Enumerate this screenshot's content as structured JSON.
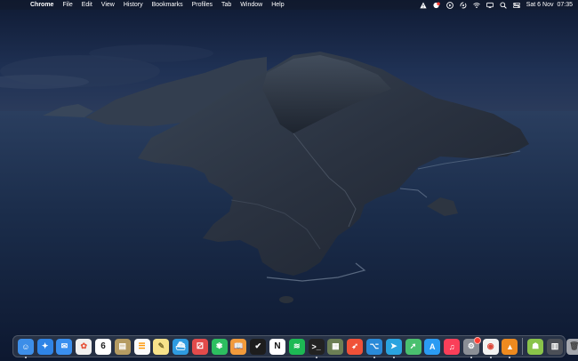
{
  "menubar": {
    "apple_glyph": "",
    "app_name": "Chrome",
    "menus": [
      "File",
      "Edit",
      "View",
      "History",
      "Bookmarks",
      "Profiles",
      "Tab",
      "Window",
      "Help"
    ],
    "status_icons": [
      "warning-triangle-icon",
      "notification-badge-icon",
      "play-circle-icon",
      "sync-icon",
      "wifi-icon",
      "screen-mirror-icon",
      "search-icon",
      "control-center-icon"
    ],
    "date": "Sat 6 Nov",
    "time": "07:35"
  },
  "dock": {
    "apps": [
      {
        "name": "finder-icon",
        "color": "#3d8ee8"
      },
      {
        "name": "safari-icon",
        "color": "#2f84e6"
      },
      {
        "name": "mail-icon",
        "color": "#3a8fef"
      },
      {
        "name": "photos-icon",
        "color": "#f0f0f0"
      },
      {
        "name": "calendar-icon",
        "color": "#ffffff",
        "text": "6"
      },
      {
        "name": "folder-app-icon",
        "color": "#b59b62"
      },
      {
        "name": "reminders-icon",
        "color": "#fafafa"
      },
      {
        "name": "notes-icon",
        "color": "#f7e28a"
      },
      {
        "name": "docker-icon",
        "color": "#2f9be0"
      },
      {
        "name": "dice-game-icon",
        "color": "#e24b4b"
      },
      {
        "name": "evernote-icon",
        "color": "#2dbe60"
      },
      {
        "name": "books-icon",
        "color": "#f19a3b"
      },
      {
        "name": "todo-app-icon",
        "color": "#1d1d1d"
      },
      {
        "name": "notion-icon",
        "color": "#ffffff",
        "text": "N"
      },
      {
        "name": "spotify-icon",
        "color": "#1db954"
      },
      {
        "name": "terminal-icon",
        "color": "#222222"
      },
      {
        "name": "grid-app-icon",
        "color": "#6c7f55"
      },
      {
        "name": "swift-icon",
        "color": "#f05138"
      },
      {
        "name": "vscode-icon",
        "color": "#2a8ad8"
      },
      {
        "name": "telegram-icon",
        "color": "#2aa3df"
      },
      {
        "name": "send-app-icon",
        "color": "#4ac06f"
      },
      {
        "name": "app-store-icon",
        "color": "#2b9bf3"
      },
      {
        "name": "music-icon",
        "color": "#fa3f59"
      },
      {
        "name": "system-preferences-icon",
        "color": "#8b8f96"
      },
      {
        "name": "chrome-icon",
        "color": "#f2f2f2"
      },
      {
        "name": "vlc-icon",
        "color": "#ee8a1f"
      }
    ],
    "right_items": [
      {
        "name": "android-icon",
        "color": "#8ac44a"
      },
      {
        "name": "downloads-stack-icon",
        "color": "#4b4f57"
      },
      {
        "name": "trash-icon",
        "color": "#a4a7ad"
      }
    ]
  }
}
